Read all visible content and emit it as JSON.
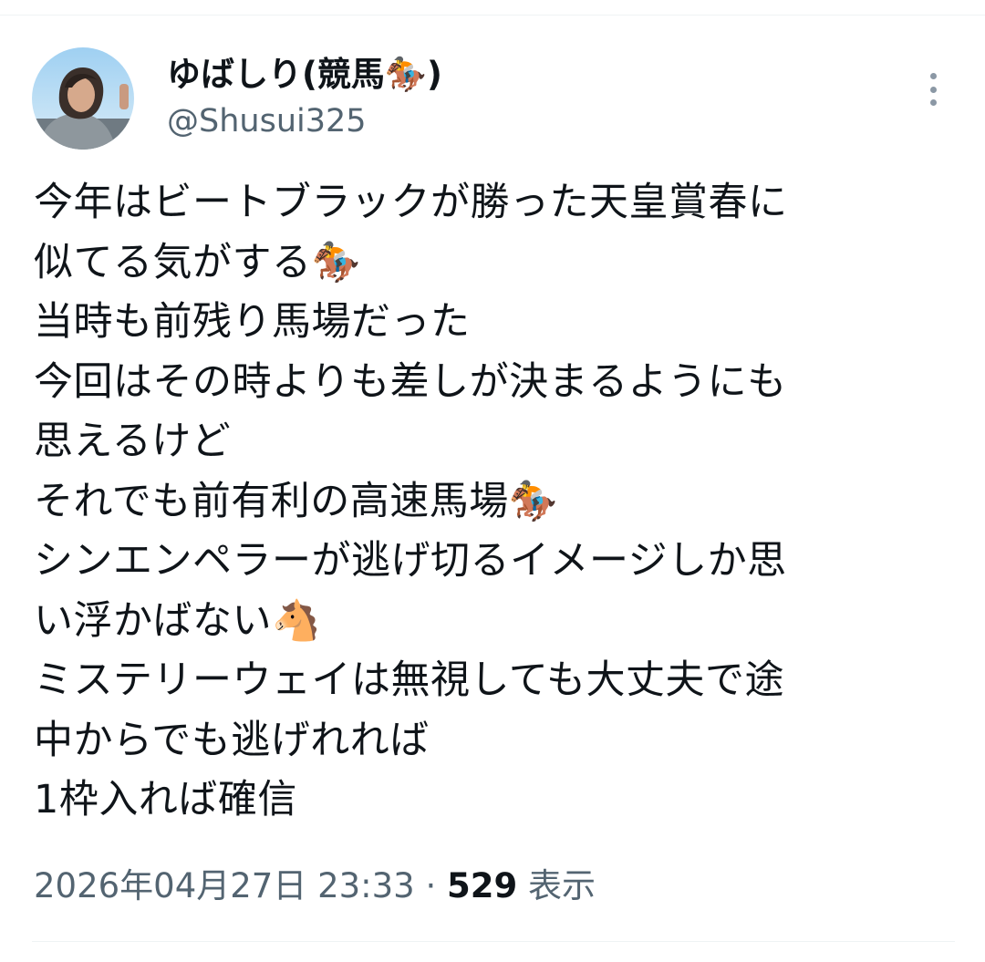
{
  "author": {
    "display_name": "ゆばしり(競馬🏇)",
    "handle": "@Shusui325"
  },
  "tweet": {
    "lines": [
      "今年はビートブラックが勝った天皇賞春に",
      "似てる気がする🏇",
      "当時も前残り馬場だった",
      "今回はその時よりも差しが決まるようにも",
      "思えるけど",
      "それでも前有利の高速馬場🏇",
      "シンエンペラーが逃げ切るイメージしか思",
      "い浮かばない🐴",
      "ミステリーウェイは無視しても大丈夫で途",
      "中からでも逃げれれば",
      "1枠入れば確信"
    ]
  },
  "meta": {
    "timestamp": "2026年04月27日 23:33",
    "separator": " · ",
    "views_count": "529",
    "views_label": " 表示"
  },
  "icons": {
    "more": "more-vertical-icon",
    "avatar": "avatar-image"
  }
}
